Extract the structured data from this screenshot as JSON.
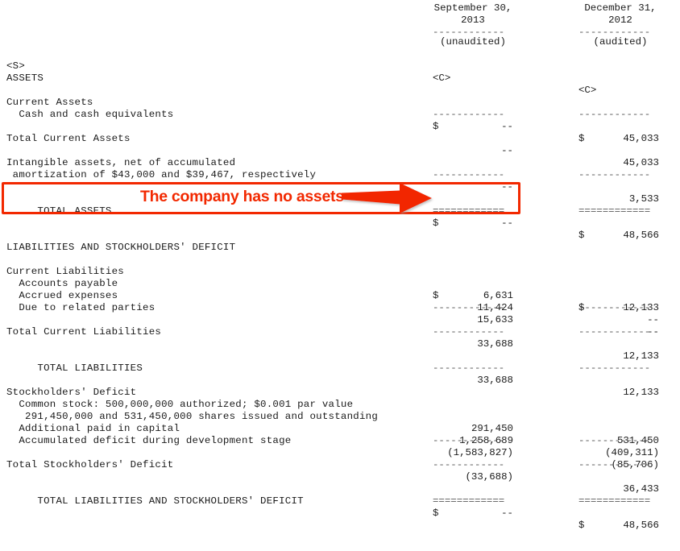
{
  "document": {
    "type": "balance-sheet",
    "tag_s": "<S>",
    "tag_c": "<C>",
    "columns": [
      {
        "date_line1": "September 30,",
        "date_line2": "2013",
        "audit_note": "(unaudited)",
        "tag": "<C>"
      },
      {
        "date_line1": "December 31,",
        "date_line2": "2012",
        "audit_note": "(audited)",
        "tag": "<C>"
      }
    ],
    "sections": [
      {
        "heading": "ASSETS",
        "rows": [
          {
            "label": "Current Assets",
            "c1": "",
            "c2": "",
            "currency1": "",
            "currency2": ""
          },
          {
            "label": "  Cash and cash equivalents",
            "currency1": "$",
            "c1": "--",
            "currency2": "$",
            "c2": "45,033"
          },
          {
            "label": "Total Current Assets",
            "c1": "--",
            "c2": "45,033"
          },
          {
            "label": "Intangible assets, net of accumulated",
            "c1": "",
            "c2": ""
          },
          {
            "label": " amortization of $43,000 and $39,467, respectively",
            "c1": "--",
            "c2": "3,533"
          },
          {
            "label": "     TOTAL ASSETS",
            "currency1": "$",
            "c1": "--",
            "currency2": "$",
            "c2": "48,566"
          }
        ]
      },
      {
        "heading": "LIABILITIES AND STOCKHOLDERS' DEFICIT",
        "rows": [
          {
            "label": "Current Liabilities",
            "c1": "",
            "c2": ""
          },
          {
            "label": "  Accounts payable",
            "currency1": "$",
            "c1": "6,631",
            "currency2": "$",
            "c2": "12,133"
          },
          {
            "label": "  Accrued expenses",
            "c1": "11,424",
            "c2": "--"
          },
          {
            "label": "  Due to related parties",
            "c1": "15,633",
            "c2": "--"
          },
          {
            "label": "Total Current Liabilities",
            "c1": "33,688",
            "c2": "12,133"
          },
          {
            "label": "     TOTAL LIABILITIES",
            "c1": "33,688",
            "c2": "12,133"
          },
          {
            "label": "Stockholders' Deficit",
            "c1": "",
            "c2": ""
          },
          {
            "label": "  Common stock: 500,000,000 authorized; $0.001 par value",
            "c1": "",
            "c2": ""
          },
          {
            "label": "   291,450,000 and 531,450,000 shares issued and outstanding",
            "c1": "291,450",
            "c2": "531,450"
          },
          {
            "label": "  Additional paid in capital",
            "c1": "1,258,689",
            "c2": "(409,311)"
          },
          {
            "label": "  Accumulated deficit during development stage",
            "c1": "(1,583,827)",
            "c2": "(85,706)"
          },
          {
            "label": "Total Stockholders' Deficit",
            "c1": "(33,688)",
            "c2": "36,433"
          },
          {
            "label": "     TOTAL LIABILITIES AND STOCKHOLDERS' DEFICIT",
            "currency1": "$",
            "c1": "--",
            "currency2": "$",
            "c2": "48,566"
          }
        ]
      }
    ],
    "rules": {
      "dash": "------------",
      "double": "============"
    }
  },
  "annotation": {
    "text": "The company has no assets",
    "color": "#f22800",
    "arrow_icon": "right-arrow-icon",
    "highlight_target": "TOTAL ASSETS"
  },
  "lines": {
    "r1_hdr_date1": "September 30,",
    "r1_hdr_year1": "2013",
    "r1_hdr_date2": "December 31,",
    "r1_hdr_year2": "2012",
    "unaudited": "(unaudited)",
    "audited": "(audited)",
    "tag_s": "<S>",
    "tag_c1": "<C>",
    "tag_c2": "<C>",
    "assets_heading": "ASSETS",
    "current_assets": "Current Assets",
    "cash": "  Cash and cash equivalents",
    "total_current_assets": "Total Current Assets",
    "intangible_1": "Intangible assets, net of accumulated",
    "intangible_2": " amortization of $43,000 and $39,467, respectively",
    "total_assets": "     TOTAL ASSETS",
    "liab_heading": "LIABILITIES AND STOCKHOLDERS' DEFICIT",
    "current_liabilities": "Current Liabilities",
    "accounts_payable": "  Accounts payable",
    "accrued_expenses": "  Accrued expenses",
    "due_related": "  Due to related parties",
    "total_current_liab": "Total Current Liabilities",
    "total_liabilities": "     TOTAL LIABILITIES",
    "sh_deficit": "Stockholders' Deficit",
    "common_stock_1": "  Common stock: 500,000,000 authorized; $0.001 par value",
    "common_stock_2": "   291,450,000 and 531,450,000 shares issued and outstanding",
    "apic": "  Additional paid in capital",
    "accum_deficit": "  Accumulated deficit during development stage",
    "total_sh_deficit": "Total Stockholders' Deficit",
    "total_liab_sh": "     TOTAL LIABILITIES AND STOCKHOLDERS' DEFICIT",
    "dash": "------------",
    "double": "============",
    "dollar": "$",
    "dashes_val": "--",
    "v_cash_2": "45,033",
    "v_tca_1": "--",
    "v_tca_2": "45,033",
    "v_intang_1": "--",
    "v_intang_2": "3,533",
    "v_ta_1": "--",
    "v_ta_2": "48,566",
    "v_ap_1": "6,631",
    "v_ap_2": "12,133",
    "v_ae_1": "11,424",
    "v_ae_2": "--",
    "v_drp_1": "15,633",
    "v_drp_2": "--",
    "v_tcl_1": "33,688",
    "v_tcl_2": "12,133",
    "v_tl_1": "33,688",
    "v_tl_2": "12,133",
    "v_cs_1": "291,450",
    "v_cs_2": "531,450",
    "v_apic_1": "1,258,689",
    "v_apic_2": "(409,311)",
    "v_ad_1": "(1,583,827)",
    "v_ad_2": "(85,706)",
    "v_tsd_1": "(33,688)",
    "v_tsd_2": "36,433",
    "v_tlsd_1": "--",
    "v_tlsd_2": "48,566"
  }
}
